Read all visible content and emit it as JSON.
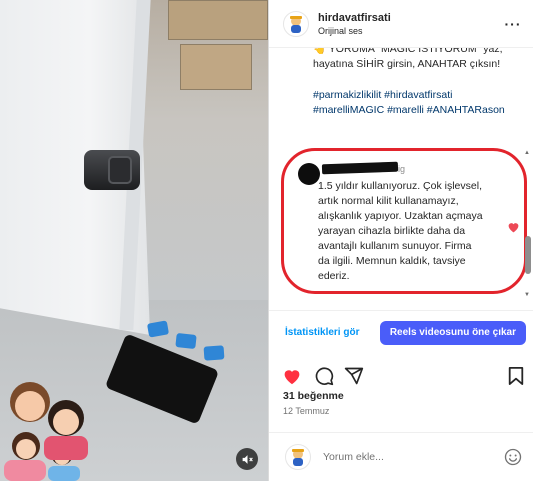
{
  "video": {
    "mute_icon": "volume-mute-icon"
  },
  "post": {
    "username": "hirdavatfirsati",
    "audio": "Orijinal ses",
    "caption": "👆 YORUMA \"MAGIC İSTİYORUM\" yaz, hayatına SİHİR girsin, ANAHTAR çıksın!",
    "hashtags": "#parmakizlikilit #hirdavatfirsati #marelliMAGIC #marelli #ANAHTARason"
  },
  "comment": {
    "user_suffix": "ig",
    "text": "1.5 yıldır kullanıyoruz. Çok işlevsel, artık normal kilit kullanamayız, alışkanlık yapıyor. Uzaktan açmaya yarayan cihazla birlikte daha da avantajlı kullanım sunuyor. Firma da ilgili. Memnun kaldık, tavsiye ederiz.",
    "highlight_color": "#e2242c",
    "heart_color": "#ed4956"
  },
  "actions": {
    "insights_label": "İstatistikleri gör",
    "boost_label": "Reels videosunu öne çıkar",
    "accent": "#0095f6",
    "boost_color": "#4a5df9"
  },
  "stats": {
    "likes": "31 beğenme",
    "date": "12 Temmuz"
  },
  "composer": {
    "placeholder": "Yorum ekle..."
  },
  "icons": [
    "heart-icon",
    "comment-icon",
    "share-icon",
    "bookmark-icon",
    "more-icon",
    "emoji-icon"
  ]
}
